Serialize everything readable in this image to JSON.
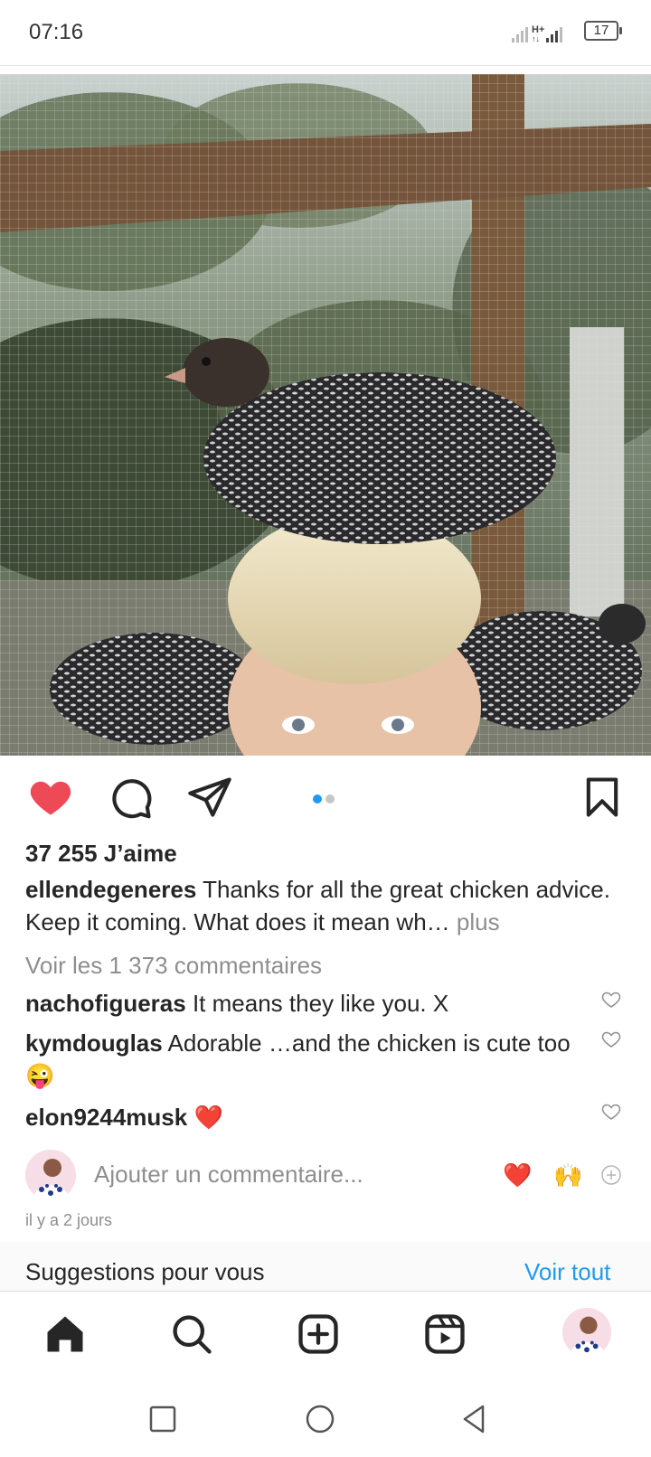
{
  "status_bar": {
    "time": "07:16",
    "network": "H+",
    "battery": "17"
  },
  "post": {
    "likes": "37 255 J’aime",
    "author": "ellendegeneres",
    "caption_text": "Thanks for all the great chicken advice. Keep it coming. What does it mean wh…",
    "caption_more": "plus",
    "view_comments": "Voir les 1 373 commentaires",
    "comments": [
      {
        "user": "nachofigueras",
        "text": "It means they like you. X"
      },
      {
        "user": "kymdouglas",
        "text": "Adorable …and the chicken is cute too😜"
      },
      {
        "user": "elon9244musk",
        "text": "❤️"
      }
    ],
    "comment_placeholder": "Ajouter un commentaire...",
    "quick_reactions": [
      "❤️",
      "🙌"
    ],
    "time_ago": "il y a 2 jours",
    "carousel": {
      "count": 2,
      "active": 1
    }
  },
  "suggestions": {
    "title": "Suggestions pour vous",
    "see_all": "Voir tout"
  },
  "icons": {
    "like": "heart-filled-icon",
    "comment": "comment-bubble-icon",
    "share": "paper-plane-icon",
    "save": "bookmark-icon",
    "nav": [
      "home-icon",
      "search-icon",
      "create-post-icon",
      "reels-icon",
      "profile-avatar"
    ],
    "android": [
      "recent-apps-icon",
      "home-circle-icon",
      "back-triangle-icon"
    ]
  },
  "colors": {
    "like_red": "#ed4956",
    "link_blue": "#1e9bf0",
    "muted_grey": "#8e8e8e",
    "text": "#262626"
  }
}
